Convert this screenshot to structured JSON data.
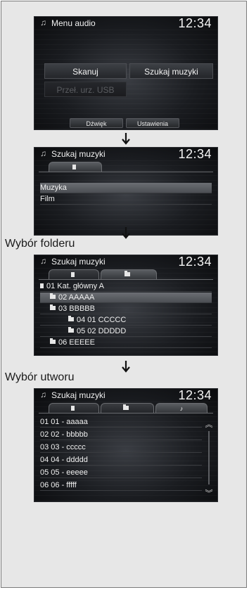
{
  "clock": "12:34",
  "screen1": {
    "title": "Menu audio",
    "buttons": [
      "Skanuj",
      "Szukaj muzyki",
      "Przeł. urz. USB"
    ],
    "bottom": [
      "Dźwięk",
      "Ustawienia"
    ]
  },
  "screen2": {
    "title": "Szukaj muzyki",
    "items": [
      "Muzyka",
      "Film"
    ]
  },
  "section3": {
    "label": "Wybór folderu"
  },
  "screen3": {
    "title": "Szukaj muzyki",
    "items": [
      "01  Kat. główny A",
      "02 AAAAA",
      "03 BBBBB",
      "04 01 CCCCC",
      "05 02 DDDDD",
      "06 EEEEE"
    ]
  },
  "section4": {
    "label": "Wybór utworu"
  },
  "screen4": {
    "title": "Szukaj muzyki",
    "items": [
      "01 01 - aaaaa",
      "02 02 - bbbbb",
      "03 03 - ccccc",
      "04 04 - ddddd",
      "05 05 - eeeee",
      "06 06 - fffff"
    ]
  },
  "icons": {
    "music": "music-note-icon",
    "disk": "usb-icon",
    "folder": "folder-icon",
    "up": "double-chevron-up-icon",
    "down": "double-chevron-down-icon",
    "arrow": "arrow-down-icon"
  }
}
